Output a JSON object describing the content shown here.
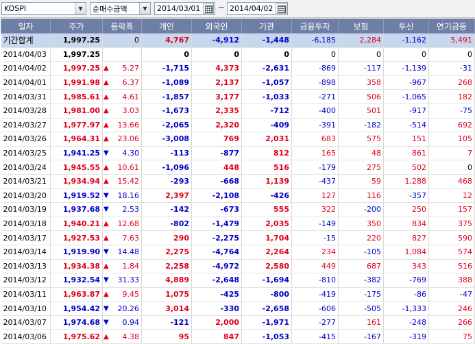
{
  "toolbar": {
    "market_value": "KOSPI",
    "type_value": "순매수금액",
    "date_from": "2014/03/01",
    "date_to": "2014/04/02",
    "tilde": "~"
  },
  "columns": [
    "일자",
    "주가",
    "등락폭",
    "개인",
    "외국인",
    "기관",
    "금융투자",
    "보험",
    "투신",
    "연기금등"
  ],
  "summary": {
    "label": "기간합계",
    "price": "1,997.25",
    "change": "0",
    "individual": "4,767",
    "foreign": "-4,912",
    "institution": "-1,448",
    "fin_invest": "-6,185",
    "insurance": "2,284",
    "trust": "-1,162",
    "pension": "5,491"
  },
  "rows": [
    {
      "date": "2014/04/03",
      "price": "1,997.25",
      "dir": "none",
      "change": "",
      "individual": "0",
      "foreign": "0",
      "institution": "0",
      "fin_invest": "0",
      "insurance": "0",
      "trust": "0",
      "pension": "0"
    },
    {
      "date": "2014/04/02",
      "price": "1,997.25",
      "dir": "up",
      "change": "5.27",
      "individual": "-1,715",
      "foreign": "4,373",
      "institution": "-2,631",
      "fin_invest": "-869",
      "insurance": "-117",
      "trust": "-1,139",
      "pension": "-31"
    },
    {
      "date": "2014/04/01",
      "price": "1,991.98",
      "dir": "up",
      "change": "6.37",
      "individual": "-1,089",
      "foreign": "2,137",
      "institution": "-1,057",
      "fin_invest": "-898",
      "insurance": "358",
      "trust": "-967",
      "pension": "268"
    },
    {
      "date": "2014/03/31",
      "price": "1,985.61",
      "dir": "up",
      "change": "4.61",
      "individual": "-1,857",
      "foreign": "3,177",
      "institution": "-1,033",
      "fin_invest": "-271",
      "insurance": "506",
      "trust": "-1,065",
      "pension": "182"
    },
    {
      "date": "2014/03/28",
      "price": "1,981.00",
      "dir": "up",
      "change": "3.03",
      "individual": "-1,673",
      "foreign": "2,335",
      "institution": "-712",
      "fin_invest": "-400",
      "insurance": "501",
      "trust": "-917",
      "pension": "-75"
    },
    {
      "date": "2014/03/27",
      "price": "1,977.97",
      "dir": "up",
      "change": "13.66",
      "individual": "-2,065",
      "foreign": "2,320",
      "institution": "-409",
      "fin_invest": "-391",
      "insurance": "-182",
      "trust": "-514",
      "pension": "692"
    },
    {
      "date": "2014/03/26",
      "price": "1,964.31",
      "dir": "up",
      "change": "23.06",
      "individual": "-3,008",
      "foreign": "769",
      "institution": "2,031",
      "fin_invest": "683",
      "insurance": "575",
      "trust": "151",
      "pension": "105"
    },
    {
      "date": "2014/03/25",
      "price": "1,941.25",
      "dir": "down",
      "change": "4.30",
      "individual": "-113",
      "foreign": "-877",
      "institution": "812",
      "fin_invest": "165",
      "insurance": "48",
      "trust": "861",
      "pension": "7"
    },
    {
      "date": "2014/03/24",
      "price": "1,945.55",
      "dir": "up",
      "change": "10.61",
      "individual": "-1,096",
      "foreign": "448",
      "institution": "516",
      "fin_invest": "-179",
      "insurance": "275",
      "trust": "502",
      "pension": "0"
    },
    {
      "date": "2014/03/21",
      "price": "1,934.94",
      "dir": "up",
      "change": "15.42",
      "individual": "-293",
      "foreign": "-668",
      "institution": "1,139",
      "fin_invest": "-437",
      "insurance": "59",
      "trust": "1,288",
      "pension": "468"
    },
    {
      "date": "2014/03/20",
      "price": "1,919.52",
      "dir": "down",
      "change": "18.16",
      "individual": "2,397",
      "foreign": "-2,108",
      "institution": "-426",
      "fin_invest": "127",
      "insurance": "116",
      "trust": "-357",
      "pension": "12"
    },
    {
      "date": "2014/03/19",
      "price": "1,937.68",
      "dir": "down",
      "change": "2.53",
      "individual": "-142",
      "foreign": "-673",
      "institution": "555",
      "fin_invest": "322",
      "insurance": "-200",
      "trust": "250",
      "pension": "157"
    },
    {
      "date": "2014/03/18",
      "price": "1,940.21",
      "dir": "up",
      "change": "12.68",
      "individual": "-802",
      "foreign": "-1,479",
      "institution": "2,035",
      "fin_invest": "-149",
      "insurance": "350",
      "trust": "834",
      "pension": "375"
    },
    {
      "date": "2014/03/17",
      "price": "1,927.53",
      "dir": "up",
      "change": "7.63",
      "individual": "290",
      "foreign": "-2,275",
      "institution": "1,704",
      "fin_invest": "-15",
      "insurance": "220",
      "trust": "827",
      "pension": "590"
    },
    {
      "date": "2014/03/14",
      "price": "1,919.90",
      "dir": "down",
      "change": "14.48",
      "individual": "2,275",
      "foreign": "-4,764",
      "institution": "2,264",
      "fin_invest": "234",
      "insurance": "-105",
      "trust": "1,084",
      "pension": "574"
    },
    {
      "date": "2014/03/13",
      "price": "1,934.38",
      "dir": "up",
      "change": "1.84",
      "individual": "2,258",
      "foreign": "-4,972",
      "institution": "2,580",
      "fin_invest": "449",
      "insurance": "687",
      "trust": "343",
      "pension": "516"
    },
    {
      "date": "2014/03/12",
      "price": "1,932.54",
      "dir": "down",
      "change": "31.33",
      "individual": "4,889",
      "foreign": "-2,648",
      "institution": "-1,694",
      "fin_invest": "-810",
      "insurance": "-382",
      "trust": "-769",
      "pension": "388"
    },
    {
      "date": "2014/03/11",
      "price": "1,963.87",
      "dir": "up",
      "change": "9.45",
      "individual": "1,075",
      "foreign": "-425",
      "institution": "-800",
      "fin_invest": "-419",
      "insurance": "-175",
      "trust": "-86",
      "pension": "-47"
    },
    {
      "date": "2014/03/10",
      "price": "1,954.42",
      "dir": "down",
      "change": "20.26",
      "individual": "3,014",
      "foreign": "-330",
      "institution": "-2,658",
      "fin_invest": "-606",
      "insurance": "-505",
      "trust": "-1,333",
      "pension": "246"
    },
    {
      "date": "2014/03/07",
      "price": "1,974.68",
      "dir": "down",
      "change": "0.94",
      "individual": "-121",
      "foreign": "2,000",
      "institution": "-1,971",
      "fin_invest": "-277",
      "insurance": "161",
      "trust": "-248",
      "pension": "266"
    },
    {
      "date": "2014/03/06",
      "price": "1,975.62",
      "dir": "up",
      "change": "4.38",
      "individual": "95",
      "foreign": "847",
      "institution": "-1,053",
      "fin_invest": "-415",
      "insurance": "-167",
      "trust": "-319",
      "pension": "75"
    }
  ],
  "colors": {
    "up": "#e0001b",
    "down": "#0000c8",
    "header_bg": "#6e7ea5",
    "summary_bg": "#c7d7ee"
  },
  "icons": {
    "dropdown": "chevron-down-icon",
    "calendar": "calendar-icon",
    "up_arrow": "triangle-up-icon",
    "down_arrow": "triangle-down-icon"
  }
}
